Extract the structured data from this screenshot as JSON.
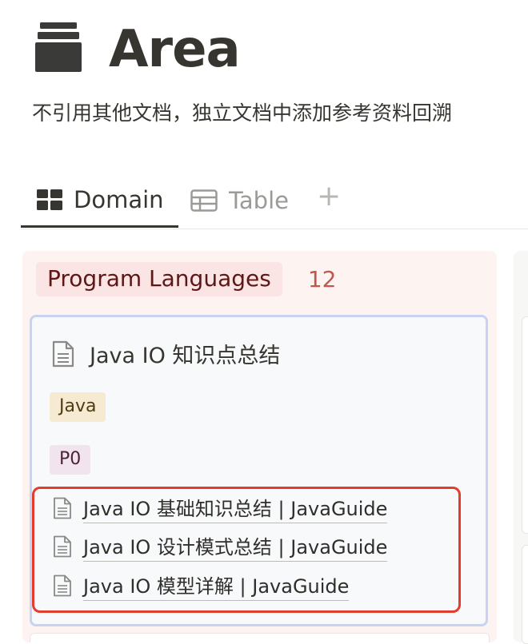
{
  "page": {
    "icon": "archive-box-icon",
    "title": "Area",
    "description": "不引用其他文档，独立文档中添加参考资料回溯"
  },
  "tabs": [
    {
      "label": "Domain",
      "icon": "board-icon",
      "active": true
    },
    {
      "label": "Table",
      "icon": "table-icon",
      "active": false
    }
  ],
  "add_view_label": "+",
  "board": {
    "group": {
      "label": "Program Languages",
      "count": "12",
      "label_bg": "#fbe4e4",
      "count_color": "#c4554d"
    },
    "card": {
      "title": "Java IO 知识点总结",
      "tags": [
        "Java",
        "P0"
      ],
      "links": [
        "Java IO 基础知识总结 | JavaGuide",
        "Java IO 设计模式总结 | JavaGuide",
        "Java IO 模型详解 | JavaGuide"
      ]
    }
  },
  "colors": {
    "highlight_border": "#e23d2d",
    "card_border": "#c6d3f2"
  }
}
